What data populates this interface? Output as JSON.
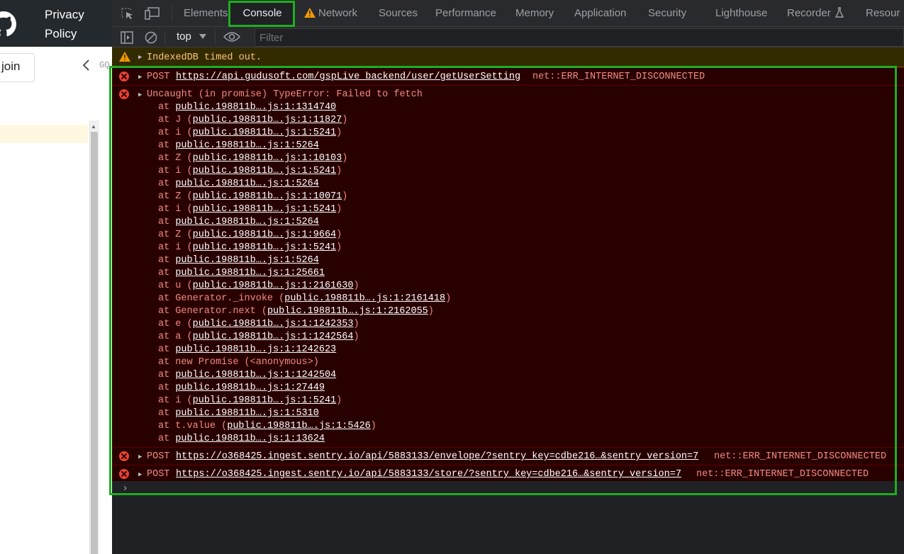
{
  "page": {
    "header": {
      "privacy_label": "Privacy\nPolicy"
    },
    "join_label": "join",
    "side_marker": "GQ"
  },
  "devtools": {
    "tabs": [
      {
        "label": "Elements"
      },
      {
        "label": "Console",
        "active": true
      },
      {
        "label": "Network",
        "warning": true
      },
      {
        "label": "Sources"
      },
      {
        "label": "Performance"
      },
      {
        "label": "Memory"
      },
      {
        "label": "Application"
      },
      {
        "label": "Security"
      },
      {
        "label": "Lighthouse"
      },
      {
        "label": "Recorder"
      },
      {
        "label": "Resour"
      }
    ],
    "toolbar": {
      "context": "top",
      "filter_placeholder": "Filter"
    },
    "console": {
      "warning": {
        "text": "IndexedDB timed out."
      },
      "errors": [
        {
          "method": "POST",
          "url": "https://api.gudusoft.com/gspLive_backend/user/getUserSetting",
          "status": "net::ERR_INTERNET_DISCONNECTED"
        },
        {
          "message": "Uncaught (in promise) TypeError: Failed to fetch",
          "stack": [
            {
              "fn": "",
              "loc": "public.198811b….js:1:1314740"
            },
            {
              "fn": "J",
              "loc": "public.198811b….js:1:11827"
            },
            {
              "fn": "i",
              "loc": "public.198811b….js:1:5241"
            },
            {
              "fn": "",
              "loc": "public.198811b….js:1:5264"
            },
            {
              "fn": "Z",
              "loc": "public.198811b….js:1:10103"
            },
            {
              "fn": "i",
              "loc": "public.198811b….js:1:5241"
            },
            {
              "fn": "",
              "loc": "public.198811b….js:1:5264"
            },
            {
              "fn": "Z",
              "loc": "public.198811b….js:1:10071"
            },
            {
              "fn": "i",
              "loc": "public.198811b….js:1:5241"
            },
            {
              "fn": "",
              "loc": "public.198811b….js:1:5264"
            },
            {
              "fn": "Z",
              "loc": "public.198811b….js:1:9664"
            },
            {
              "fn": "i",
              "loc": "public.198811b….js:1:5241"
            },
            {
              "fn": "",
              "loc": "public.198811b….js:1:5264"
            },
            {
              "fn": "",
              "loc": "public.198811b….js:1:25661"
            },
            {
              "fn": "u",
              "loc": "public.198811b….js:1:2161630"
            },
            {
              "fn": "Generator._invoke",
              "loc": "public.198811b….js:1:2161418"
            },
            {
              "fn": "Generator.next",
              "loc": "public.198811b….js:1:2162055"
            },
            {
              "fn": "e",
              "loc": "public.198811b….js:1:1242353"
            },
            {
              "fn": "a",
              "loc": "public.198811b….js:1:1242564"
            },
            {
              "fn": "",
              "loc": "public.198811b….js:1:1242623"
            },
            {
              "fn": "new Promise",
              "loc": "<anonymous>",
              "plain": true
            },
            {
              "fn": "",
              "loc": "public.198811b….js:1:1242504"
            },
            {
              "fn": "",
              "loc": "public.198811b….js:1:27449"
            },
            {
              "fn": "i",
              "loc": "public.198811b….js:1:5241"
            },
            {
              "fn": "",
              "loc": "public.198811b….js:1:5310"
            },
            {
              "fn": "t.value",
              "loc": "public.198811b….js:1:5426"
            },
            {
              "fn": "",
              "loc": "public.198811b….js:1:13624"
            }
          ]
        },
        {
          "method": "POST",
          "url": "https://o368425.ingest.sentry.io/api/5883133/envelope/?sentry_key=cdbe216…&sentry_version=7",
          "status": "net::ERR_INTERNET_DISCONNECTED"
        },
        {
          "method": "POST",
          "url": "https://o368425.ingest.sentry.io/api/5883133/store/?sentry_key=cdbe216…&sentry_version=7",
          "status": "net::ERR_INTERNET_DISCONNECTED"
        }
      ]
    }
  },
  "colors": {
    "highlight": "#1fae1f",
    "error_bg": "#290000",
    "error_text": "#f28b82",
    "warning_text": "#ffc477"
  }
}
